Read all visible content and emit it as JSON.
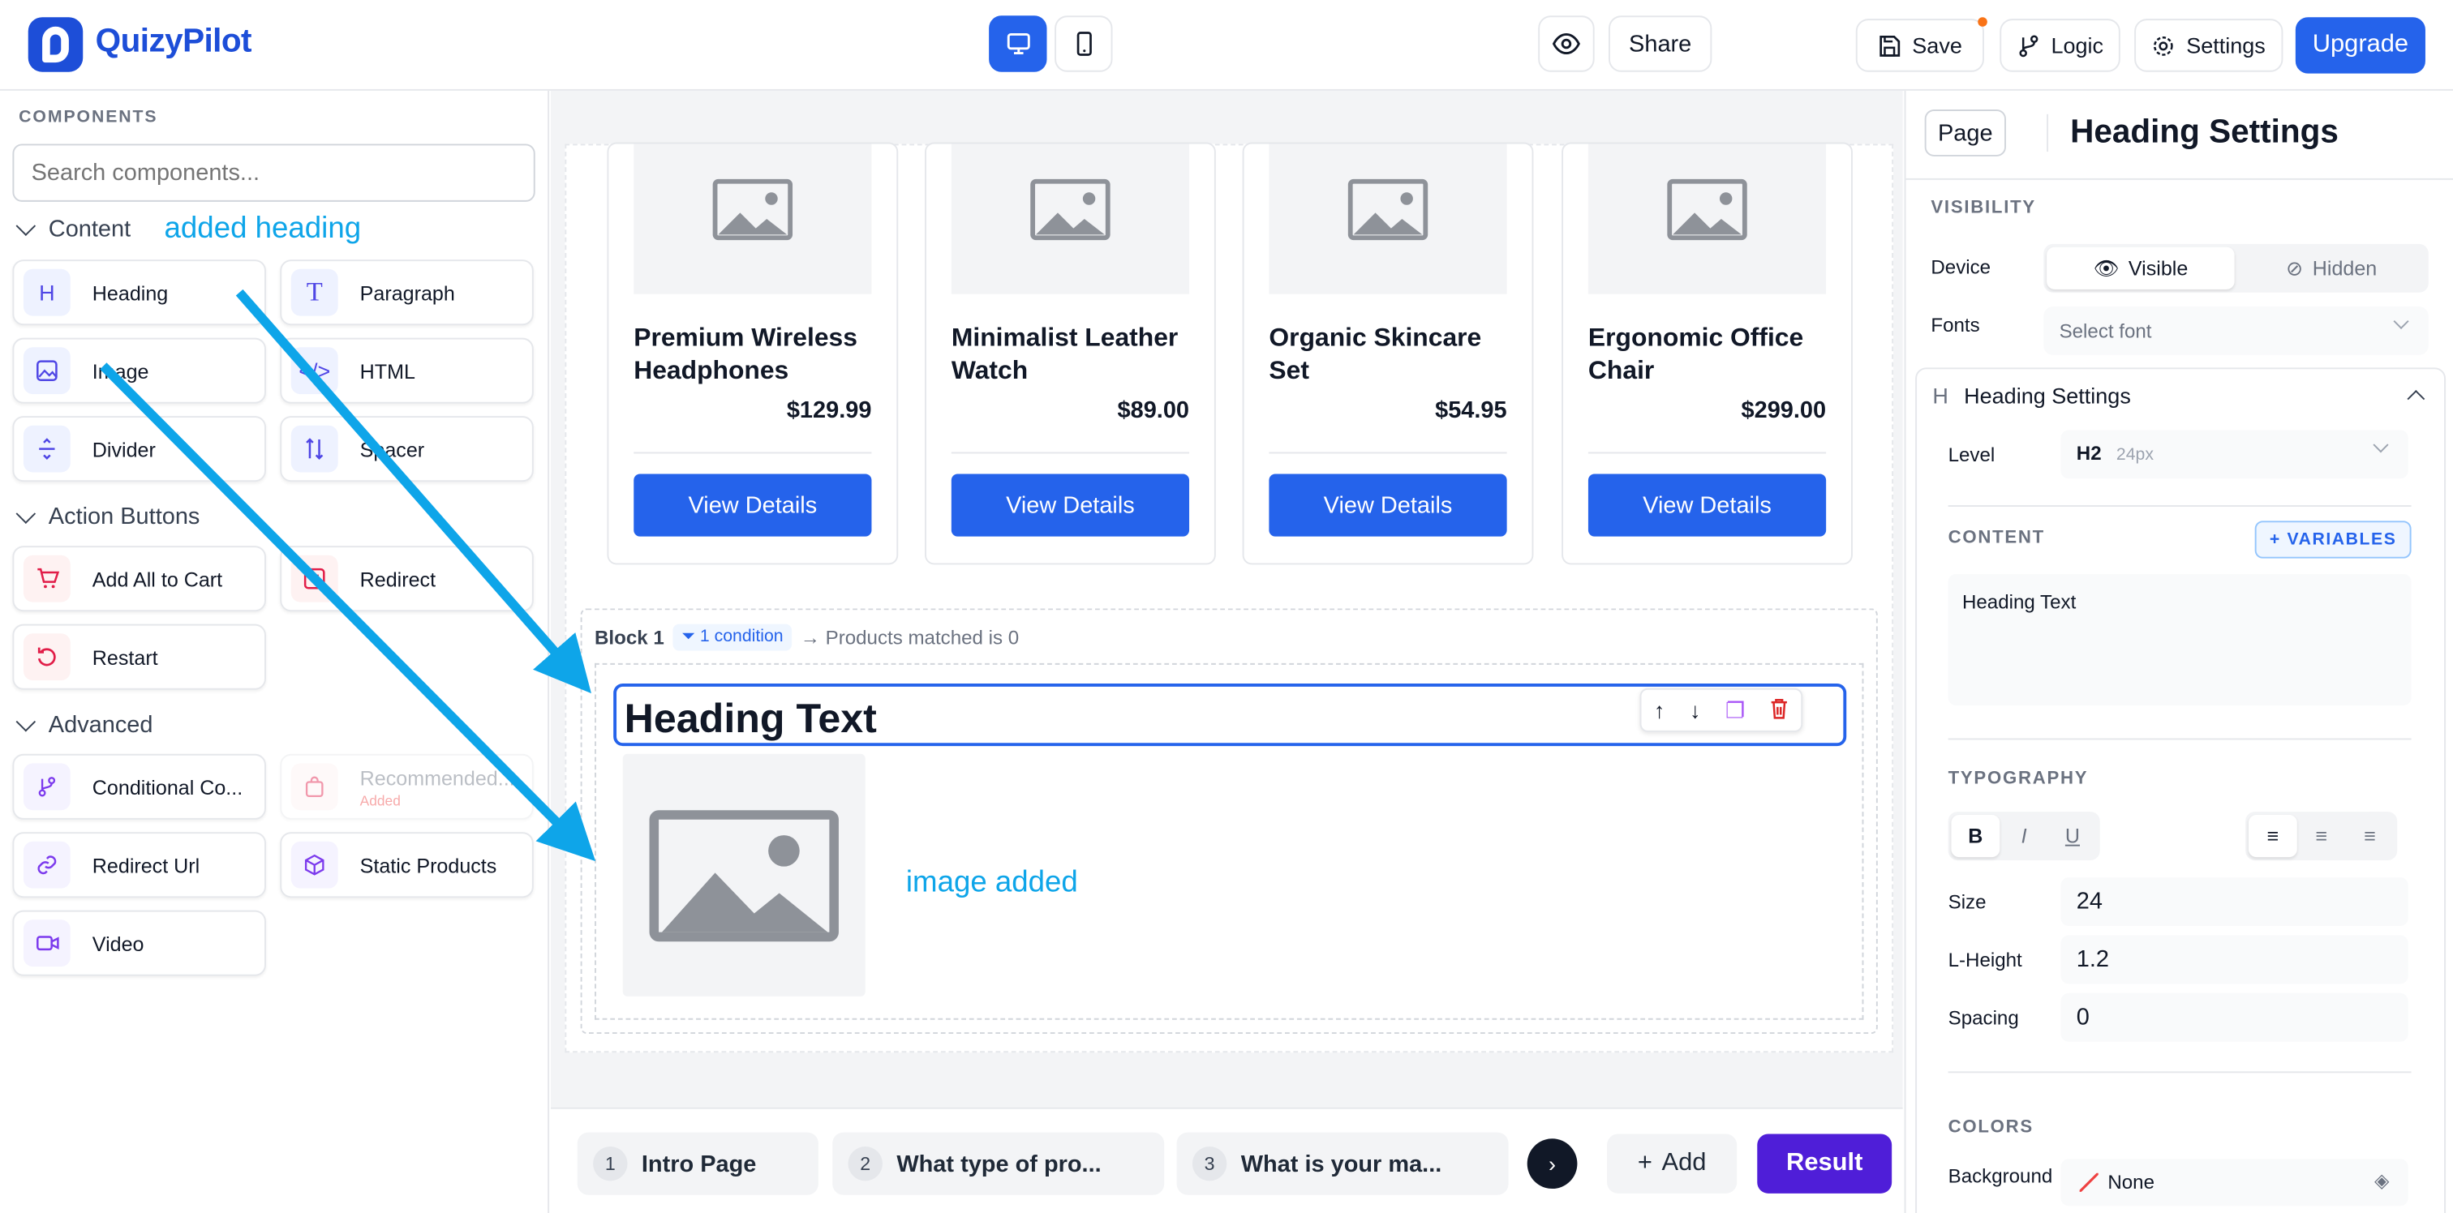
{
  "app": {
    "name": "QuizyPilot"
  },
  "topbar": {
    "share": "Share",
    "save": "Save",
    "logic": "Logic",
    "settings": "Settings",
    "upgrade": "Upgrade"
  },
  "left": {
    "title": "COMPONENTS",
    "search_placeholder": "Search components...",
    "sections": {
      "content": "Content",
      "action": "Action Buttons",
      "advanced": "Advanced"
    },
    "items": {
      "heading": "Heading",
      "paragraph": "Paragraph",
      "image": "Image",
      "html": "HTML",
      "divider": "Divider",
      "spacer": "Spacer",
      "add_all": "Add All to Cart",
      "redirect": "Redirect",
      "restart": "Restart",
      "conditional": "Conditional Co...",
      "recommended": "Recommended...",
      "recommended_sub": "Added",
      "redirect_url": "Redirect Url",
      "static_products": "Static Products",
      "video": "Video"
    }
  },
  "canvas": {
    "products": [
      {
        "name": "Premium Wireless Headphones",
        "price": "$129.99",
        "button": "View Details"
      },
      {
        "name": "Minimalist Leather Watch",
        "price": "$89.00",
        "button": "View Details"
      },
      {
        "name": "Organic Skincare Set",
        "price": "$54.95",
        "button": "View Details"
      },
      {
        "name": "Ergonomic Office Chair",
        "price": "$299.00",
        "button": "View Details"
      }
    ],
    "block": {
      "label": "Block 1",
      "condition": "1 condition",
      "rule": "→ Products matched is 0",
      "heading": "Heading Text"
    }
  },
  "pages": {
    "tabs": [
      {
        "num": "1",
        "label": "Intro Page"
      },
      {
        "num": "2",
        "label": "What type of pro..."
      },
      {
        "num": "3",
        "label": "What is your ma..."
      }
    ],
    "add": "Add",
    "result": "Result"
  },
  "right": {
    "page_btn": "Page",
    "title": "Heading Settings",
    "visibility_cap": "VISIBILITY",
    "device_label": "Device",
    "visible": "Visible",
    "hidden": "Hidden",
    "fonts_label": "Fonts",
    "fonts_placeholder": "Select font",
    "section_title": "Heading Settings",
    "level_label": "Level",
    "level_value": "H2",
    "level_hint": "24px",
    "content_cap": "CONTENT",
    "variables": "VARIABLES",
    "content_value": "Heading Text",
    "typography_cap": "TYPOGRAPHY",
    "size_label": "Size",
    "size_value": "24",
    "lheight_label": "L-Height",
    "lheight_value": "1.2",
    "spacing_label": "Spacing",
    "spacing_value": "0",
    "colors_cap": "COLORS",
    "background_label": "Background",
    "background_value": "None"
  },
  "annotations": {
    "heading_note": "added heading",
    "image_note": "image added"
  },
  "colors": {
    "brand": "#1d4ed8",
    "primary": "#2563eb",
    "result": "#4f1ed8",
    "annotation": "#0ea5e9"
  }
}
